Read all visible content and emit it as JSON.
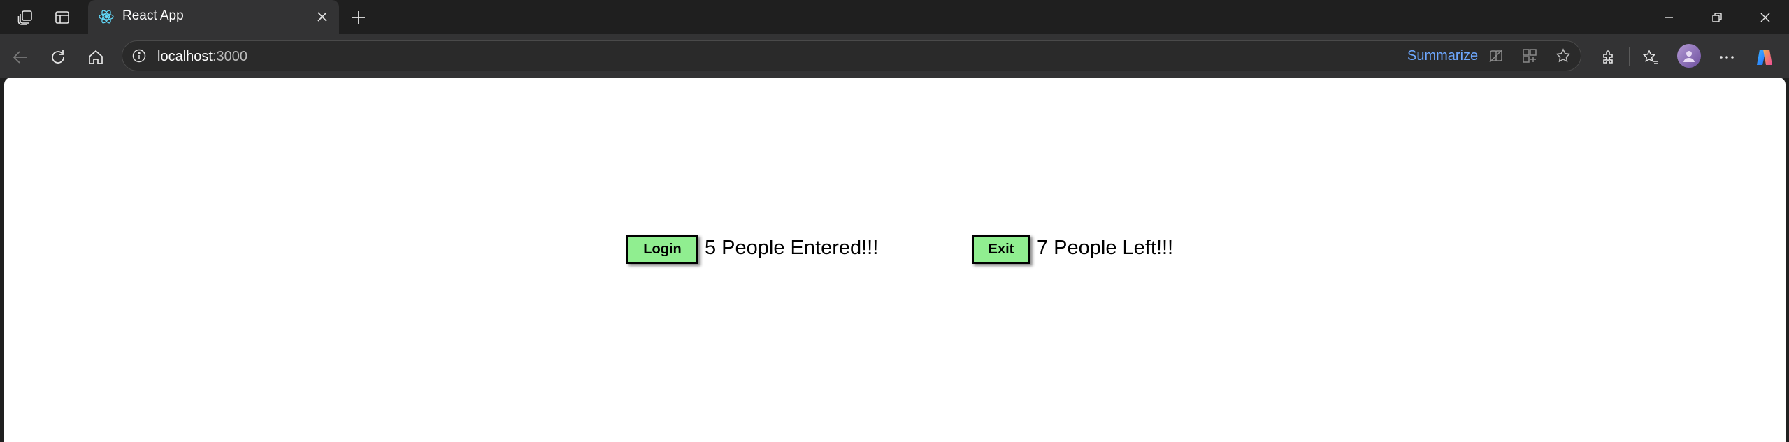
{
  "browser": {
    "tab": {
      "title": "React App"
    },
    "address_bar": {
      "host": "localhost",
      "port": ":3000"
    },
    "summarize_label": "Summarize"
  },
  "app": {
    "login_button": "Login",
    "entered_text": "5 People Entered!!!",
    "exit_button": "Exit",
    "left_text": "7 People Left!!!",
    "button_color": "#90ee90"
  }
}
